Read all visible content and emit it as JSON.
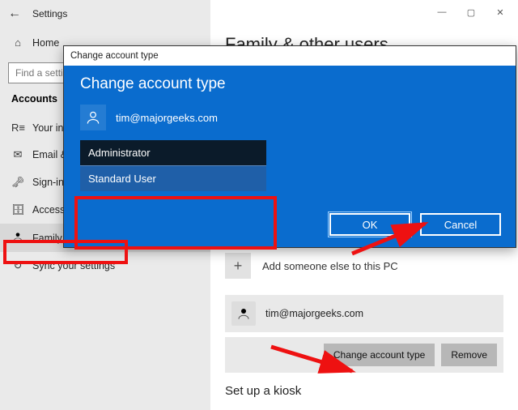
{
  "window": {
    "title": "Settings",
    "minimize": "—",
    "maximize": "▢",
    "close": "✕"
  },
  "sidebar": {
    "home": "Home",
    "search_placeholder": "Find a setting",
    "section": "Accounts",
    "items": [
      {
        "icon": "R≡",
        "label": "Your info"
      },
      {
        "icon": "✉",
        "label": "Email & accounts"
      },
      {
        "icon": "🗝",
        "label": "Sign-in options"
      },
      {
        "icon": "🗄",
        "label": "Access work or school"
      },
      {
        "icon": "👥",
        "label": "Family & other users"
      },
      {
        "icon": "↻",
        "label": "Sync your settings"
      }
    ]
  },
  "main": {
    "page_title": "Family & other users",
    "add_label": "Add someone else to this PC",
    "user_email": "tim@majorgeeks.com",
    "change_btn": "Change account type",
    "remove_btn": "Remove",
    "kiosk_heading": "Set up a kiosk"
  },
  "dialog": {
    "titlebar": "Change account type",
    "heading": "Change account type",
    "user_email": "tim@majorgeeks.com",
    "options": {
      "admin": "Administrator",
      "standard": "Standard User"
    },
    "ok": "OK",
    "cancel": "Cancel"
  }
}
